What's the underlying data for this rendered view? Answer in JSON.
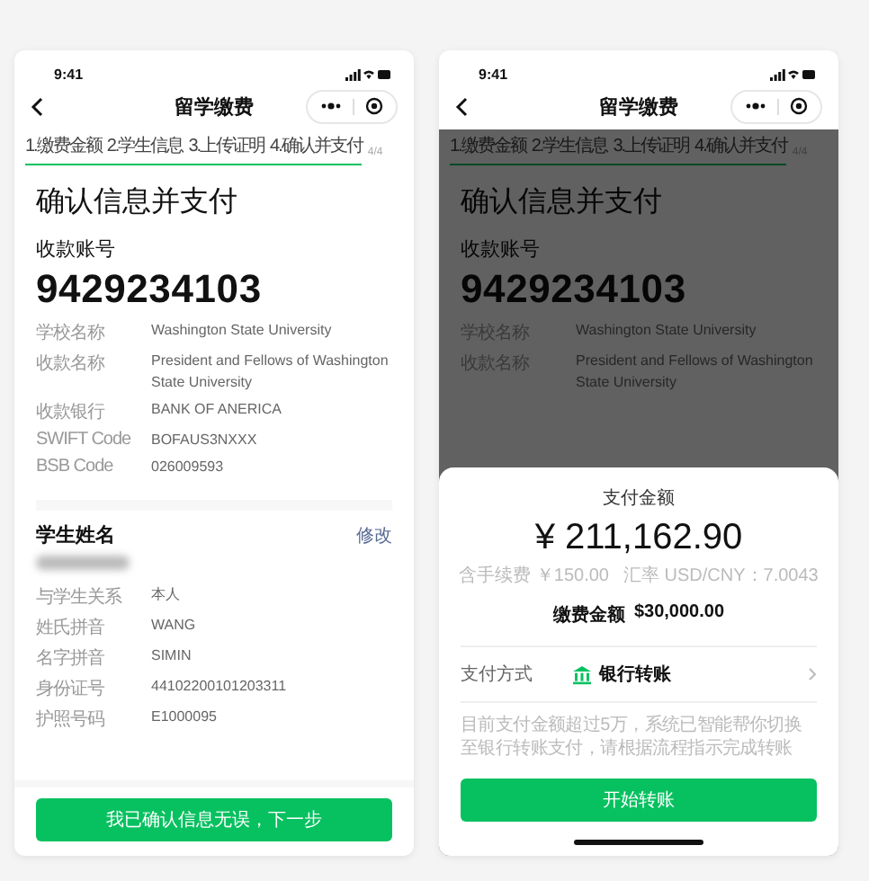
{
  "screens": [
    {
      "status_time": "9:41",
      "title": "留学缴费",
      "steps": [
        {
          "label": "1.缴费金额"
        },
        {
          "label": "2.学生信息"
        },
        {
          "label": "3.上传证明"
        },
        {
          "label": "4.确认并支付"
        }
      ],
      "step_count": "4/4",
      "overlay": false,
      "heading": "确认信息并支付",
      "account_label": "收款账号",
      "account_number": "9429234103",
      "account_rows": [
        {
          "label": "学校名称",
          "value": "Washington State University"
        },
        {
          "label": "收款名称",
          "value": "President and Fellows of Washington State University"
        },
        {
          "label": "收款银行",
          "value": "BANK OF ANERICA"
        },
        {
          "label": "SWIFT Code",
          "value": "BOFAUS3NXXX"
        },
        {
          "label": "BSB Code",
          "value": "026009593"
        }
      ],
      "student": {
        "title": "学生姓名",
        "edit": "修改",
        "rows": [
          {
            "label": "与学生关系",
            "value": "本人"
          },
          {
            "label": "姓氏拼音",
            "value": "WANG"
          },
          {
            "label": "名字拼音",
            "value": "SIMIN"
          },
          {
            "label": "身份证号",
            "value": "44102200101203311"
          },
          {
            "label": "护照号码",
            "value": "E1000095"
          }
        ]
      },
      "button": "我已确认信息无误，下一步"
    },
    {
      "status_time": "9:41",
      "title": "留学缴费",
      "steps": [
        {
          "label": "1.缴费金额"
        },
        {
          "label": "2.学生信息"
        },
        {
          "label": "3.上传证明"
        },
        {
          "label": "4.确认并支付"
        }
      ],
      "step_count": "4/4",
      "overlay": true,
      "heading": "确认信息并支付",
      "account_label": "收款账号",
      "account_number": "9429234103",
      "account_rows": [
        {
          "label": "学校名称",
          "value": "Washington State University"
        },
        {
          "label": "收款名称",
          "value": "President and Fellows of Washington State University"
        }
      ],
      "sheet": {
        "title": "支付金额",
        "amount": "¥ 211,162.90",
        "fee": "含手续费 ￥150.00",
        "rate": "汇率 USD/CNY：7.0043",
        "paid_label": "缴费金额",
        "paid_value": "$30,000.00",
        "method_label": "支付方式",
        "method": "银行转账",
        "note": "目前支付金额超过5万，系统已智能帮你切换至银行转账支付，请根据流程指示完成转账",
        "button": "开始转账"
      }
    }
  ]
}
